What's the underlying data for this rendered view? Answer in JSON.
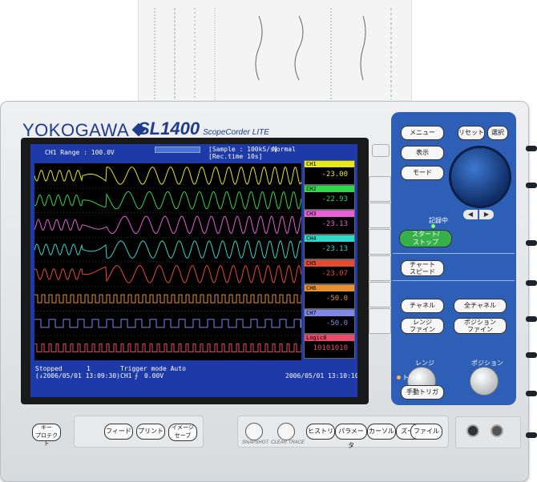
{
  "brand": {
    "name": "YOKOGAWA",
    "model": "SL1400",
    "model_sub": "ScopeCorder LITE"
  },
  "screen": {
    "range_text": "CH1 Range : 100.0V",
    "sample_text": "[Sample : 100kS/s]",
    "trigger_mode": "Normal",
    "rec_time_text": "[Rec.time     10s]",
    "channels": [
      {
        "label": "CH1",
        "value": "-23.00",
        "color": "#e8e81a"
      },
      {
        "label": "CH2",
        "value": "-22.93",
        "color": "#2fd84a"
      },
      {
        "label": "CH3",
        "value": "-23.13",
        "color": "#e85fd8"
      },
      {
        "label": "CH4",
        "value": "-23.13",
        "color": "#2fd8c8"
      },
      {
        "label": "CH5",
        "value": "-23.07",
        "color": "#e84a2f"
      },
      {
        "label": "CH6",
        "value": "-50.0",
        "color": "#e8902f"
      },
      {
        "label": "CH7",
        "value": "-50.0",
        "color": "#7f88e8"
      },
      {
        "label": "Logic8",
        "value": "10101010",
        "color": "#e84a6a"
      }
    ],
    "status": "Stopped",
    "status_count": "1",
    "trigger_text": "Trigger mode  Auto",
    "start_time": "(↓2006/05/01 13:09:30)",
    "trigger_channel": "CH1",
    "trigger_level": "0.00V",
    "end_time": "2006/05/01 13:10:10"
  },
  "panel": {
    "menu": "メニュー",
    "reset": "リセット",
    "select": "選択",
    "display": "表示",
    "mode": "モード",
    "recording": "記録中",
    "start_stop": "スタート/\nストップ",
    "chart_speed": "チャート\nスピード",
    "channel": "チャネル",
    "all_channels": "全チャネル",
    "range_fine": "レンジ\nファイン",
    "position_fine": "ポジション\nファイン",
    "range": "レンジ",
    "position": "ポジション",
    "trigger": "トリガ",
    "manual_trigger": "手動トリガ"
  },
  "bottom": {
    "key_protect": "キー\nプロテクト",
    "feed": "フィード",
    "print": "プリント",
    "image_save": "イメージ\nセーブ",
    "snapshot": "SNAPSHOT",
    "clear_trace": "CLEAR TRACE",
    "history": "ヒストリ",
    "parameter": "パラメータ",
    "cursor": "カーソル",
    "zoom": "ズーム",
    "file": "ファイル"
  }
}
